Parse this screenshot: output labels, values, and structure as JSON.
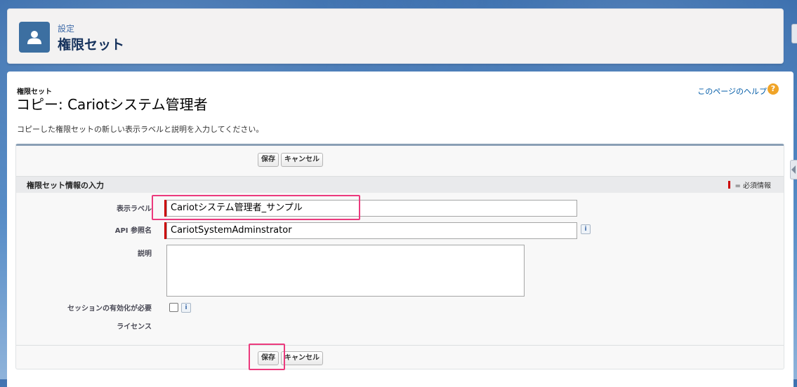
{
  "header": {
    "breadcrumb": "設定",
    "title": "権限セット",
    "icon": "user-icon"
  },
  "page": {
    "subtitle": "権限セット",
    "title": "コピー: Cariotシステム管理者",
    "help_link": "このページのヘルプ",
    "help_icon": "?",
    "description": "コピーした権限セットの新しい表示ラベルと説明を入力してください。"
  },
  "buttons": {
    "save": "保存",
    "cancel": "キャンセル"
  },
  "section": {
    "title": "権限セット情報の入力",
    "required_legend": "= 必須情報"
  },
  "fields": {
    "label": {
      "label": "表示ラベル",
      "value": "Cariotシステム管理者_サンプル"
    },
    "api_name": {
      "label": "API 参照名",
      "value": "CariotSystemAdminstrator"
    },
    "description": {
      "label": "説明",
      "value": ""
    },
    "session_required": {
      "label": "セッションの有効化が必要",
      "checked": false
    },
    "license": {
      "label": "ライセンス",
      "value": ""
    }
  },
  "info_icon": "i",
  "colors": {
    "required": "#cc0000",
    "highlight": "#ec3a7d",
    "link": "#015ba7",
    "header_icon": "#3c6fa1"
  }
}
